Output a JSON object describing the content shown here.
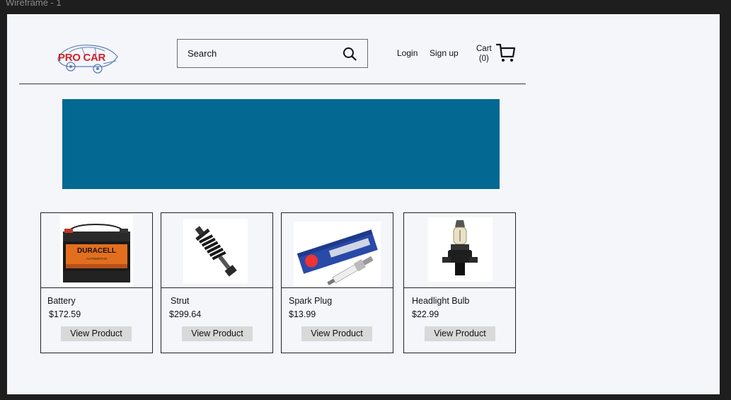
{
  "frame": {
    "label": "Wireframe - 1"
  },
  "header": {
    "logo_text": "PRO CAR",
    "search": {
      "placeholder": "Search"
    },
    "login_label": "Login",
    "signup_label": "Sign up",
    "cart": {
      "label": "Cart",
      "count": "(0)"
    }
  },
  "colors": {
    "banner": "#036892",
    "logo_red": "#d3232a",
    "logo_blue": "#5b7fb6",
    "button_bg": "#d9d9d9",
    "frame_bg": "#f4f6fa"
  },
  "products": [
    {
      "name": "Battery",
      "price": "$172.59",
      "button": "View Product",
      "image": "duracell-battery-image"
    },
    {
      "name": "Strut",
      "price": "$299.64",
      "button": "View Product",
      "image": "strut-image"
    },
    {
      "name": "Spark Plug",
      "price": "$13.99",
      "button": "View Product",
      "image": "iridium-spark-plug-image"
    },
    {
      "name": "Headlight Bulb",
      "price": "$22.99",
      "button": "View Product",
      "image": "headlight-bulb-image"
    }
  ],
  "product_image_text": {
    "battery_brand": "DURACELL",
    "battery_sub": "AUTOMOTIVE"
  }
}
